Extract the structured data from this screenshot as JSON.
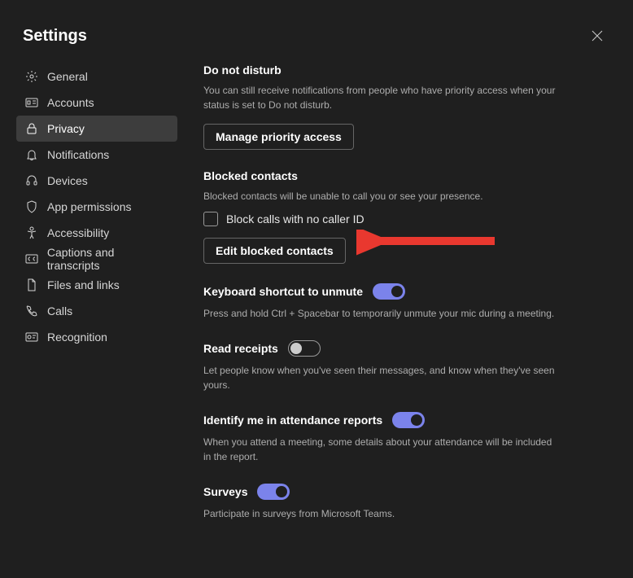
{
  "header": {
    "title": "Settings"
  },
  "sidebar": {
    "items": [
      {
        "label": "General",
        "icon": "gear"
      },
      {
        "label": "Accounts",
        "icon": "id-card"
      },
      {
        "label": "Privacy",
        "icon": "lock",
        "active": true
      },
      {
        "label": "Notifications",
        "icon": "bell"
      },
      {
        "label": "Devices",
        "icon": "headset"
      },
      {
        "label": "App permissions",
        "icon": "shield"
      },
      {
        "label": "Accessibility",
        "icon": "person"
      },
      {
        "label": "Captions and transcripts",
        "icon": "cc"
      },
      {
        "label": "Files and links",
        "icon": "file"
      },
      {
        "label": "Calls",
        "icon": "phone"
      },
      {
        "label": "Recognition",
        "icon": "badge"
      }
    ]
  },
  "sections": {
    "dnd": {
      "title": "Do not disturb",
      "desc": "You can still receive notifications from people who have priority access when your status is set to Do not disturb.",
      "button": "Manage priority access"
    },
    "blocked": {
      "title": "Blocked contacts",
      "desc": "Blocked contacts will be unable to call you or see your presence.",
      "checkbox_label": "Block calls with no caller ID",
      "checkbox_checked": false,
      "button": "Edit blocked contacts"
    },
    "shortcut": {
      "title": "Keyboard shortcut to unmute",
      "toggle": true,
      "desc": "Press and hold Ctrl + Spacebar to temporarily unmute your mic during a meeting."
    },
    "receipts": {
      "title": "Read receipts",
      "toggle": false,
      "desc": "Let people know when you've seen their messages, and know when they've seen yours."
    },
    "attendance": {
      "title": "Identify me in attendance reports",
      "toggle": true,
      "desc": "When you attend a meeting, some details about your attendance will be included in the report."
    },
    "surveys": {
      "title": "Surveys",
      "toggle": true,
      "desc": "Participate in surveys from Microsoft Teams."
    }
  }
}
